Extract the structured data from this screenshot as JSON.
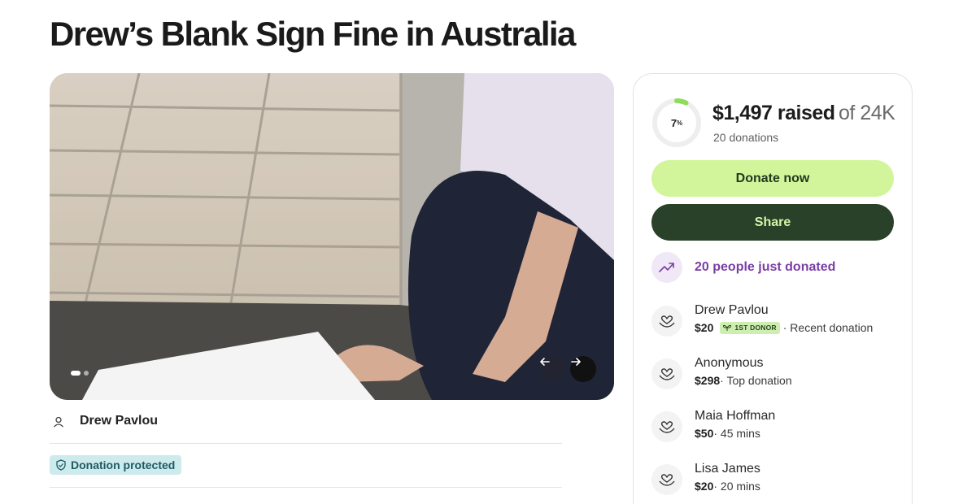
{
  "page": {
    "title": "Drew’s Blank Sign Fine in Australia"
  },
  "media": {
    "prev_icon": "arrow-left-icon",
    "next_icon": "arrow-right-icon",
    "slide_index": 1
  },
  "organizer": {
    "name": "Drew Pavlou",
    "icon": "user-icon"
  },
  "protection": {
    "label": "Donation protected",
    "icon": "shield-icon"
  },
  "fundraiser": {
    "progress_percent": 7,
    "progress_label": "7",
    "progress_suffix": "%",
    "raised_amount": "$1,497 raised",
    "goal_text": "of 24K",
    "donations_count": "20 donations",
    "donate_label": "Donate now",
    "share_label": "Share",
    "activity_text": "20 people just donated",
    "activity_icon": "trending-up-icon"
  },
  "donors": [
    {
      "name": "Drew Pavlou",
      "amount": "$20",
      "badge": "1ST DONOR",
      "note": " · Recent donation"
    },
    {
      "name": "Anonymous",
      "amount": "$298",
      "badge": "",
      "note": " · Top donation"
    },
    {
      "name": "Maia Hoffman",
      "amount": "$50",
      "badge": "",
      "note": " · 45 mins"
    },
    {
      "name": "Lisa James",
      "amount": "$20",
      "badge": "",
      "note": " · 20 mins"
    }
  ],
  "colors": {
    "brand_green_light": "#d2f59b",
    "brand_green_dark": "#284128",
    "activity_purple": "#7a3ea6",
    "protected_bg": "#cdeaec",
    "progress_green": "#8fdc5a"
  }
}
